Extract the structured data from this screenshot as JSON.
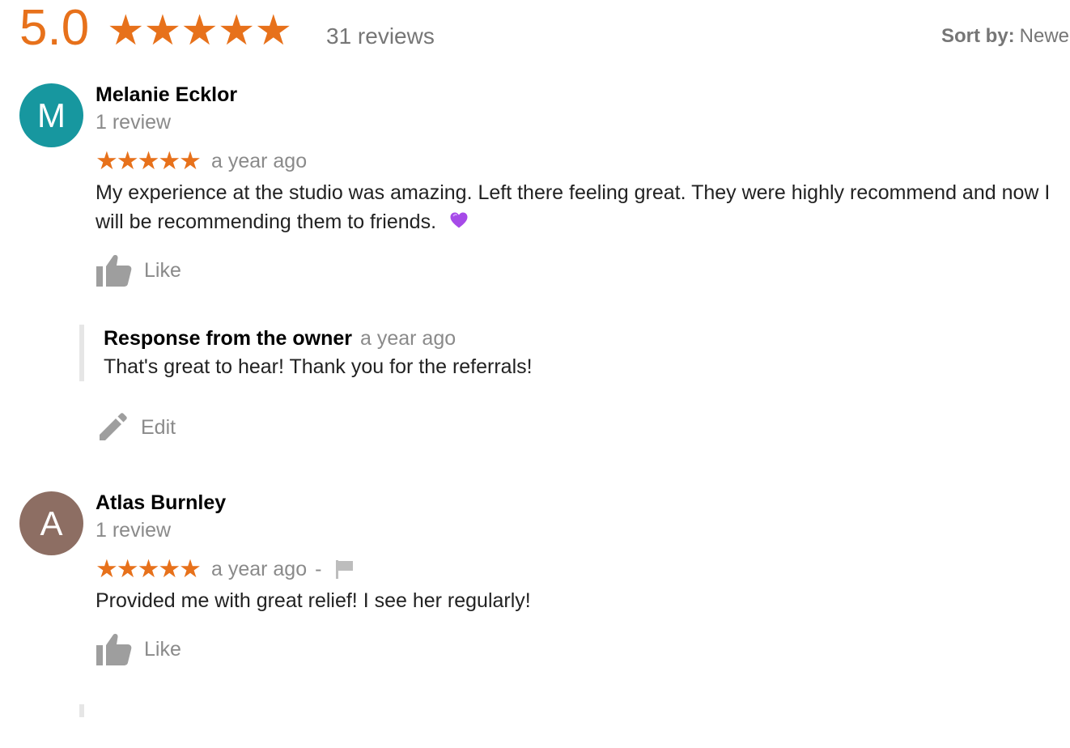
{
  "summary": {
    "score": "5.0",
    "stars": "★★★★★",
    "review_count": "31 reviews",
    "sort_label": "Sort by:",
    "sort_value": "Newe"
  },
  "reviews": [
    {
      "avatar_letter": "M",
      "avatar_color": "#17979f",
      "name": "Melanie Ecklor",
      "count": "1 review",
      "stars": "★★★★★",
      "rating": 5,
      "time": "a year ago",
      "text": "My experience at the studio was amazing. Left there feeling great. They were highly recommend and now I will be recommending them to friends.",
      "emoji_icon": "purple-heart-icon",
      "like_label": "Like",
      "owner_response": {
        "title": "Response from the owner",
        "time": "a year ago",
        "text": "That's great to hear! Thank you for the referrals!"
      },
      "edit_label": "Edit"
    },
    {
      "avatar_letter": "A",
      "avatar_color": "#8d6e63",
      "name": "Atlas Burnley",
      "count": "1 review",
      "stars": "★★★★★",
      "rating": 5,
      "time": "a year ago",
      "separator": "-",
      "flag_icon": "flag-icon",
      "text": "Provided me with great relief! I see her regularly!",
      "like_label": "Like"
    }
  ],
  "colors": {
    "accent": "#e7711b",
    "muted_text": "#8a8a8a",
    "icon_gray": "#9e9e9e"
  }
}
